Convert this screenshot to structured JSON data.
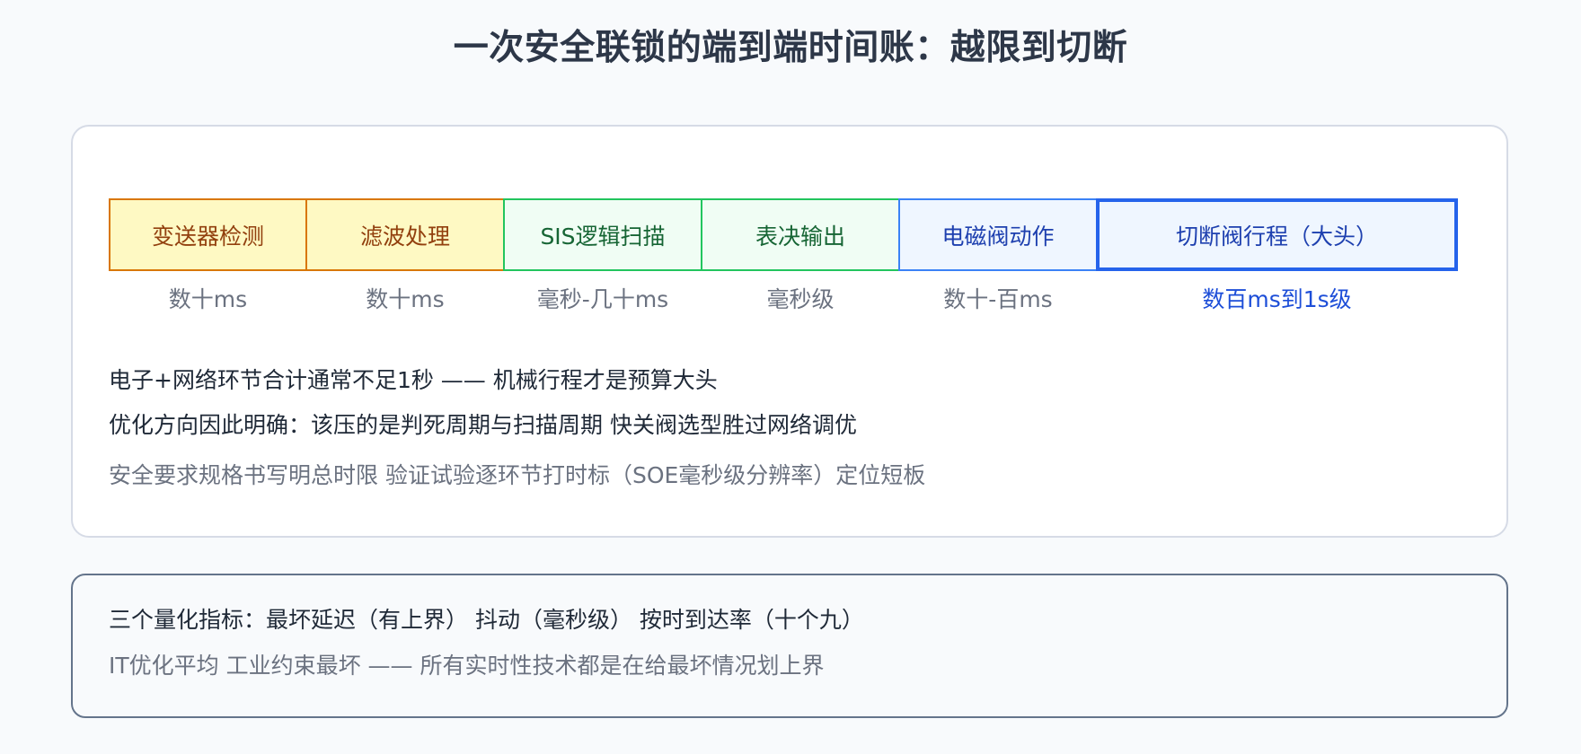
{
  "title": "一次安全联锁的端到端时间账：越限到切断",
  "pipeline": [
    {
      "label": "变送器检测",
      "duration": "数十ms"
    },
    {
      "label": "滤波处理",
      "duration": "数十ms"
    },
    {
      "label": "SIS逻辑扫描",
      "duration": "毫秒-几十ms"
    },
    {
      "label": "表决输出",
      "duration": "毫秒级"
    },
    {
      "label": "电磁阀动作",
      "duration": "数十-百ms"
    },
    {
      "label": "切断阀行程（大头）",
      "duration": "数百ms到1s级"
    }
  ],
  "notes": [
    "电子+网络环节合计通常不足1秒 —— 机械行程才是预算大头",
    "优化方向因此明确：该压的是判死周期与扫描周期 快关阀选型胜过网络调优",
    "安全要求规格书写明总时限 验证试验逐环节打时标（SOE毫秒级分辨率）定位短板"
  ],
  "summary": [
    "三个量化指标：最坏延迟（有上界） 抖动（毫秒级） 按时到达率（十个九）",
    "IT优化平均 工业约束最坏 —— 所有实时性技术都是在给最坏情况划上界"
  ]
}
